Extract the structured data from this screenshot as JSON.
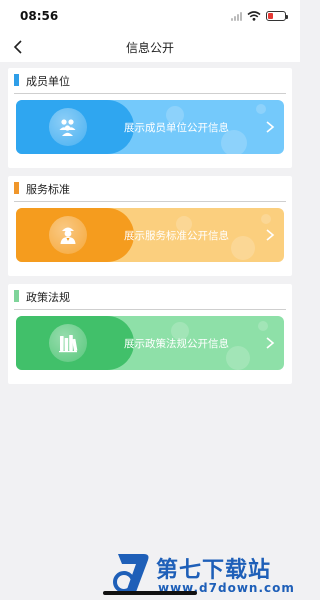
{
  "status": {
    "time": "08:56"
  },
  "nav": {
    "title": "信息公开"
  },
  "sections": [
    {
      "title": "成员单位",
      "banner_text": "展示成员单位公开信息",
      "icon": "members-icon",
      "marker_color": "#2f9ee8",
      "accent_light": "#74c9fb",
      "accent_dark": "#2fa6f0"
    },
    {
      "title": "服务标准",
      "banner_text": "展示服务标准公开信息",
      "icon": "service-staff-icon",
      "marker_color": "#f0962a",
      "accent_light": "#fbcf7e",
      "accent_dark": "#f59c1e"
    },
    {
      "title": "政策法规",
      "banner_text": "展示政策法规公开信息",
      "icon": "law-books-icon",
      "marker_color": "#7fd49a",
      "accent_light": "#8ee0a8",
      "accent_dark": "#41c06a"
    }
  ],
  "watermark": {
    "title": "第七下载站",
    "url": "www.d7down.com"
  }
}
